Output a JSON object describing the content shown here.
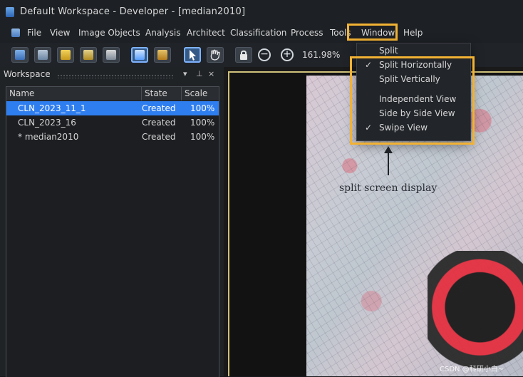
{
  "window": {
    "title": "Default Workspace - Developer - [median2010]"
  },
  "menubar": {
    "items": [
      "File",
      "View",
      "Image Objects",
      "Analysis",
      "Architect",
      "Classification",
      "Process",
      "Tools",
      "Window",
      "Help"
    ]
  },
  "toolbar": {
    "zoom": "161.98%"
  },
  "workspace": {
    "title": "Workspace",
    "columns": [
      "Name",
      "State",
      "Scale"
    ],
    "rows": [
      {
        "name": "CLN_2023_11_1",
        "state": "Created",
        "scale": "100%"
      },
      {
        "name": "CLN_2023_16",
        "state": "Created",
        "scale": "100%"
      },
      {
        "name": "* median2010",
        "state": "Created",
        "scale": "100%"
      }
    ]
  },
  "window_menu": {
    "items": [
      {
        "label": "Split",
        "checked": false
      },
      {
        "label": "Split Horizontally",
        "checked": true
      },
      {
        "label": "Split Vertically",
        "checked": false
      },
      {
        "label": "Independent View",
        "checked": false
      },
      {
        "label": "Side by Side View",
        "checked": false
      },
      {
        "label": "Swipe View",
        "checked": true
      }
    ]
  },
  "annotation": {
    "text": "split screen display"
  },
  "watermark": {
    "text": "CSDN @科研小白~"
  },
  "colors": {
    "highlight": "#f2b233",
    "selection": "#2f7ef0"
  }
}
